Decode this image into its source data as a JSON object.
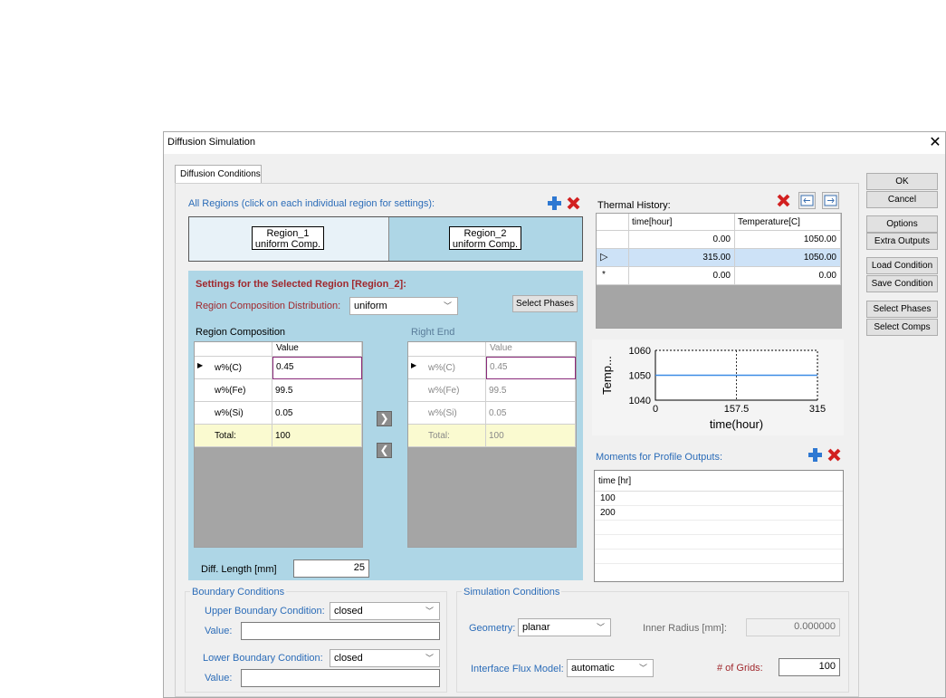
{
  "window": {
    "title": "Diffusion Simulation"
  },
  "tabs": [
    {
      "label": "Diffusion Conditions"
    }
  ],
  "regions": {
    "header": "All Regions (click on each individual region for settings):",
    "items": [
      {
        "name": "Region_1",
        "comp": "uniform Comp."
      },
      {
        "name": "Region_2",
        "comp": "uniform Comp."
      }
    ]
  },
  "selected_region": {
    "title": "Settings for the Selected Region [Region_2]:",
    "dist_label": "Region Composition Distribution:",
    "dist_value": "uniform",
    "select_phases_btn": "Select Phases",
    "comp_label": "Region Composition",
    "right_end_label": "Right End",
    "table_header": "Value",
    "rows": [
      {
        "name": "w%(C)",
        "value": "0.45"
      },
      {
        "name": "w%(Fe)",
        "value": "99.5"
      },
      {
        "name": "w%(Si)",
        "value": "0.05"
      },
      {
        "name": "Total:",
        "value": "100"
      }
    ],
    "diff_length_label": "Diff. Length [mm]",
    "diff_length_value": "25"
  },
  "thermal": {
    "label": "Thermal History:",
    "headers": [
      "time[hour]",
      "Temperature[C]"
    ],
    "rows": [
      {
        "mark": "",
        "time": "0.00",
        "temp": "1050.00"
      },
      {
        "mark": "▷",
        "time": "315.00",
        "temp": "1050.00"
      },
      {
        "mark": "*",
        "time": "0.00",
        "temp": "0.00"
      }
    ]
  },
  "chart_data": {
    "type": "line",
    "x": [
      0,
      315
    ],
    "series": [
      {
        "values": [
          1050,
          1050
        ]
      }
    ],
    "xlabel": "time(hour)",
    "ylabel": "Temp...",
    "xticks": [
      "0",
      "157.5",
      "315"
    ],
    "yticks": [
      "1060",
      "1050",
      "1040"
    ],
    "xlim": [
      0,
      315
    ],
    "ylim": [
      1040,
      1060
    ],
    "grid": "dashed",
    "color": "#3c8ce6"
  },
  "moments": {
    "label": "Moments for Profile Outputs:",
    "header": "time [hr]",
    "values": [
      "100",
      "200"
    ]
  },
  "boundary": {
    "label": "Boundary Conditions",
    "upper_label": "Upper Boundary Condition:",
    "upper_value": "closed",
    "lower_label": "Lower Boundary Condition:",
    "lower_value": "closed",
    "value_label": "Value:"
  },
  "simulation": {
    "label": "Simulation Conditions",
    "geometry_label": "Geometry:",
    "geometry_value": "planar",
    "inner_radius_label": "Inner Radius [mm]:",
    "inner_radius_value": "0.000000",
    "flux_label": "Interface Flux Model:",
    "flux_value": "automatic",
    "grids_label": "# of Grids:",
    "grids_value": "100"
  },
  "side_buttons": {
    "ok": "OK",
    "cancel": "Cancel",
    "options": "Options",
    "extra_outputs": "Extra Outputs",
    "load_condition": "Load Condition",
    "save_condition": "Save Condition",
    "select_phases": "Select Phases",
    "select_comps": "Select Comps"
  },
  "colors": {
    "region_panel": "#aed6e6",
    "accent_blue": "#2b6cb8",
    "accent_red": "#a0282d"
  }
}
